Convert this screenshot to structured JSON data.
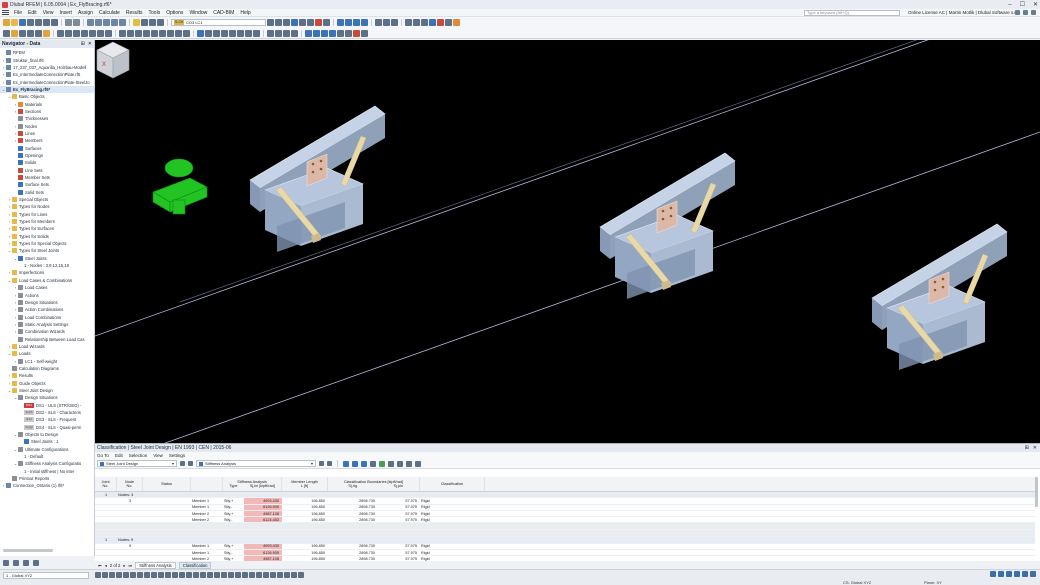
{
  "app": {
    "title": "Dlubal RFEM | 6.05.0004 | Ex_FlyBracing.rf6*",
    "window_controls": [
      "–",
      "☐",
      "✕"
    ]
  },
  "menu": {
    "items": [
      "File",
      "Edit",
      "View",
      "Insert",
      "Assign",
      "Calculate",
      "Results",
      "Tools",
      "Options",
      "Window",
      "CAD-BIM",
      "Help"
    ],
    "search_placeholder": "Type a keyword (Alt+Q)",
    "license": "Online License AC | Martin Motlik | Dlubal Software s.r.o."
  },
  "toolbar": {
    "load_case_tag": "S-Ch",
    "load_case": "CO3  LC1"
  },
  "navigator": {
    "title": "Navigator - Data",
    "items": [
      {
        "depth": 0,
        "tw": "",
        "icon": "ic-model",
        "icon_name": "rfem-icon",
        "label": "RFEM"
      },
      {
        "depth": 0,
        "tw": "›",
        "icon": "ic-model",
        "icon_name": "model-icon",
        "label": "Struktur_final.rf6"
      },
      {
        "depth": 0,
        "tw": "›",
        "icon": "ic-model",
        "icon_name": "model-icon",
        "label": "17_237_037_Aquarilla_Holzbau-Modell"
      },
      {
        "depth": 0,
        "tw": "›",
        "icon": "ic-model",
        "icon_name": "model-icon",
        "label": "Ex_IntermediateConnectionPlate.rf6"
      },
      {
        "depth": 0,
        "tw": "›",
        "icon": "ic-model",
        "icon_name": "model-icon",
        "label": "Ex_IntermediateConnectionPlate-SteelJo"
      },
      {
        "depth": 0,
        "tw": "⌄",
        "icon": "ic-model",
        "icon_name": "model-icon",
        "label": "Ex_FlyBracing.rf6*",
        "active": true
      },
      {
        "depth": 1,
        "tw": "⌄",
        "icon": "ic-folder",
        "icon_name": "folder-icon",
        "label": "Basic Objects"
      },
      {
        "depth": 2,
        "tw": "›",
        "icon": "ic-orange",
        "icon_name": "materials-icon",
        "label": "Materials"
      },
      {
        "depth": 2,
        "tw": "›",
        "icon": "ic-red",
        "icon_name": "sections-icon",
        "label": "Sections"
      },
      {
        "depth": 2,
        "tw": "",
        "icon": "ic-gray",
        "icon_name": "thicknesses-icon",
        "label": "Thicknesses"
      },
      {
        "depth": 2,
        "tw": "›",
        "icon": "ic-gray",
        "icon_name": "nodes-icon",
        "label": "Nodes"
      },
      {
        "depth": 2,
        "tw": "›",
        "icon": "ic-red",
        "icon_name": "lines-icon",
        "label": "Lines"
      },
      {
        "depth": 2,
        "tw": "›",
        "icon": "ic-red",
        "icon_name": "members-icon",
        "label": "Members"
      },
      {
        "depth": 2,
        "tw": "",
        "icon": "ic-blue",
        "icon_name": "surfaces-icon",
        "label": "Surfaces"
      },
      {
        "depth": 2,
        "tw": "",
        "icon": "ic-blue",
        "icon_name": "openings-icon",
        "label": "Openings"
      },
      {
        "depth": 2,
        "tw": "",
        "icon": "ic-blue",
        "icon_name": "solids-icon",
        "label": "Solids"
      },
      {
        "depth": 2,
        "tw": "",
        "icon": "ic-red",
        "icon_name": "line-sets-icon",
        "label": "Line Sets"
      },
      {
        "depth": 2,
        "tw": "",
        "icon": "ic-red",
        "icon_name": "member-sets-icon",
        "label": "Member Sets"
      },
      {
        "depth": 2,
        "tw": "",
        "icon": "ic-blue",
        "icon_name": "surface-sets-icon",
        "label": "Surface Sets"
      },
      {
        "depth": 2,
        "tw": "",
        "icon": "ic-blue",
        "icon_name": "solid-sets-icon",
        "label": "Solid Sets"
      },
      {
        "depth": 1,
        "tw": "›",
        "icon": "ic-folder",
        "icon_name": "folder-icon",
        "label": "Special Objects"
      },
      {
        "depth": 1,
        "tw": "›",
        "icon": "ic-folder",
        "icon_name": "folder-icon",
        "label": "Types for Nodes"
      },
      {
        "depth": 1,
        "tw": "›",
        "icon": "ic-folder",
        "icon_name": "folder-icon",
        "label": "Types for Lines"
      },
      {
        "depth": 1,
        "tw": "›",
        "icon": "ic-folder",
        "icon_name": "folder-icon",
        "label": "Types for Members"
      },
      {
        "depth": 1,
        "tw": "›",
        "icon": "ic-folder",
        "icon_name": "folder-icon",
        "label": "Types for Surfaces"
      },
      {
        "depth": 1,
        "tw": "›",
        "icon": "ic-folder",
        "icon_name": "folder-icon",
        "label": "Types for Solids"
      },
      {
        "depth": 1,
        "tw": "›",
        "icon": "ic-folder",
        "icon_name": "folder-icon",
        "label": "Types for Special Objects"
      },
      {
        "depth": 1,
        "tw": "⌄",
        "icon": "ic-folder",
        "icon_name": "folder-icon",
        "label": "Types for Steel Joints"
      },
      {
        "depth": 2,
        "tw": "⌄",
        "icon": "ic-blue",
        "icon_name": "steel-joints-icon",
        "label": "Steel Joints"
      },
      {
        "depth": 3,
        "tw": "",
        "icon": "",
        "icon_name": "",
        "label": "1 - Nodes : 3,9,12,15,18"
      },
      {
        "depth": 1,
        "tw": "›",
        "icon": "ic-folder",
        "icon_name": "folder-icon",
        "label": "Imperfections"
      },
      {
        "depth": 1,
        "tw": "⌄",
        "icon": "ic-folder",
        "icon_name": "folder-icon",
        "label": "Load Cases & Combinations"
      },
      {
        "depth": 2,
        "tw": "›",
        "icon": "ic-gray",
        "icon_name": "load-cases-icon",
        "label": "Load Cases"
      },
      {
        "depth": 2,
        "tw": "›",
        "icon": "ic-gray",
        "icon_name": "actions-icon",
        "label": "Actions"
      },
      {
        "depth": 2,
        "tw": "›",
        "icon": "ic-gray",
        "icon_name": "design-situations-icon",
        "label": "Design Situations"
      },
      {
        "depth": 2,
        "tw": "›",
        "icon": "ic-gray",
        "icon_name": "action-combinations-icon",
        "label": "Action Combinations"
      },
      {
        "depth": 2,
        "tw": "›",
        "icon": "ic-gray",
        "icon_name": "load-combinations-icon",
        "label": "Load Combinations"
      },
      {
        "depth": 2,
        "tw": "›",
        "icon": "ic-gray",
        "icon_name": "static-analysis-settings-icon",
        "label": "Static Analysis Settings"
      },
      {
        "depth": 2,
        "tw": "›",
        "icon": "ic-gray",
        "icon_name": "combination-wizards-icon",
        "label": "Combination Wizards"
      },
      {
        "depth": 2,
        "tw": "",
        "icon": "ic-gray",
        "icon_name": "relationship-icon",
        "label": "Relationship Between Load Cas"
      },
      {
        "depth": 1,
        "tw": "›",
        "icon": "ic-folder",
        "icon_name": "folder-icon",
        "label": "Load Wizards"
      },
      {
        "depth": 1,
        "tw": "⌄",
        "icon": "ic-folder",
        "icon_name": "folder-icon",
        "label": "Loads"
      },
      {
        "depth": 2,
        "tw": "›",
        "icon": "ic-gray",
        "icon_name": "load-case-icon",
        "label": "LC1 - Self-weight"
      },
      {
        "depth": 1,
        "tw": "",
        "icon": "ic-gray",
        "icon_name": "calculation-diagrams-icon",
        "label": "Calculation Diagrams"
      },
      {
        "depth": 1,
        "tw": "›",
        "icon": "ic-folder",
        "icon_name": "folder-icon",
        "label": "Results"
      },
      {
        "depth": 1,
        "tw": "›",
        "icon": "ic-folder",
        "icon_name": "folder-icon",
        "label": "Guide Objects"
      },
      {
        "depth": 1,
        "tw": "⌄",
        "icon": "ic-folder",
        "icon_name": "folder-icon",
        "label": "Steel Joint Design"
      },
      {
        "depth": 2,
        "tw": "⌄",
        "icon": "ic-gray",
        "icon_name": "design-situations-icon",
        "label": "Design Situations"
      },
      {
        "depth": 3,
        "tw": "",
        "icon": "ic-tag red",
        "icon_tag": "DS1",
        "icon_name": "ds-tag-icon",
        "label": "DS1 - ULS (STR/GEO) -"
      },
      {
        "depth": 3,
        "tw": "",
        "icon": "ic-tag",
        "icon_tag": "S-Ch",
        "icon_name": "ds-tag-icon",
        "label": "DS2 - SLS - Characteris"
      },
      {
        "depth": 3,
        "tw": "",
        "icon": "ic-tag",
        "icon_tag": "S-Fr",
        "icon_name": "ds-tag-icon",
        "label": "DS3 - SLS - Frequent"
      },
      {
        "depth": 3,
        "tw": "",
        "icon": "ic-tag",
        "icon_tag": "S-Qp",
        "icon_name": "ds-tag-icon",
        "label": "DS4 - SLS - Quasi-perm"
      },
      {
        "depth": 2,
        "tw": "⌄",
        "icon": "ic-gray",
        "icon_name": "objects-to-design-icon",
        "label": "Objects to Design"
      },
      {
        "depth": 3,
        "tw": "",
        "icon": "ic-blue",
        "icon_name": "steel-joints-icon",
        "label": "Steel Joints : 1"
      },
      {
        "depth": 2,
        "tw": "⌄",
        "icon": "ic-gray",
        "icon_name": "ultimate-configurations-icon",
        "label": "Ultimate Configurations"
      },
      {
        "depth": 3,
        "tw": "",
        "icon": "",
        "icon_name": "",
        "label": "1 - Default"
      },
      {
        "depth": 2,
        "tw": "⌄",
        "icon": "ic-gray",
        "icon_name": "stiffness-config-icon",
        "label": "Stiffness Analysis Configuratio"
      },
      {
        "depth": 3,
        "tw": "",
        "icon": "",
        "icon_name": "",
        "label": "1 - Initial stiffness | No inter"
      },
      {
        "depth": 1,
        "tw": "",
        "icon": "ic-gray",
        "icon_name": "printout-reports-icon",
        "label": "Printout Reports"
      },
      {
        "depth": 0,
        "tw": "›",
        "icon": "ic-model",
        "icon_name": "model-icon",
        "label": "Connection_Ontario (1).rf6*"
      }
    ]
  },
  "panel": {
    "title": "Classification | Steel Joint Design | EN 1993 | CEN | 2015-06",
    "menu": [
      "Go To",
      "Edit",
      "Selection",
      "View",
      "Settings"
    ],
    "combo_module": "Steel Joint Design",
    "combo_analysis": "Stiffness Analysis",
    "headers": {
      "joint": [
        "Joint",
        "No."
      ],
      "node": [
        "Node",
        "No."
      ],
      "status": [
        "",
        "Status"
      ],
      "blank": [
        "",
        ""
      ],
      "type": [
        "Stiffness Analysis",
        "Type"
      ],
      "sj": [
        "",
        "Sj,ini [kipft/rad]"
      ],
      "len": [
        "Member Length",
        "L [ft]"
      ],
      "bounds_title": "Classification Boundaries [kipft/rad]",
      "sjr": "Sj,rig",
      "sjp": "Sj,pin",
      "class": [
        "",
        "Classification"
      ]
    },
    "rows": [
      {
        "kind": "group",
        "joint": "1",
        "node": "Nodes: 3"
      },
      {
        "kind": "data",
        "node": "3",
        "member": "Member 1",
        "type": "Stiy,+",
        "sj": "4993.430",
        "len": "196.850",
        "sjr": "2898.730",
        "sjp": "57.975",
        "cls": "Rigid"
      },
      {
        "kind": "data",
        "node": "",
        "member": "Member 1",
        "type": "Stiy,-",
        "sj": "6126.905",
        "len": "196.850",
        "sjr": "2898.730",
        "sjp": "57.975",
        "cls": "Rigid"
      },
      {
        "kind": "data",
        "node": "",
        "member": "Member 2",
        "type": "Stiy,+",
        "sj": "4987.108",
        "len": "196.850",
        "sjr": "2898.730",
        "sjp": "57.975",
        "cls": "Rigid"
      },
      {
        "kind": "data",
        "node": "",
        "member": "Member 2",
        "type": "Stiy,-",
        "sj": "6124.453",
        "len": "196.850",
        "sjr": "2898.730",
        "sjp": "57.975",
        "cls": "Rigid"
      },
      {
        "kind": "spacer"
      },
      {
        "kind": "spacer"
      },
      {
        "kind": "group",
        "joint": "1",
        "node": "Nodes: 9"
      },
      {
        "kind": "data",
        "node": "9",
        "member": "Member 1",
        "type": "Stiy,+",
        "sj": "4993.430",
        "len": "196.850",
        "sjr": "2898.730",
        "sjp": "57.975",
        "cls": "Rigid"
      },
      {
        "kind": "data",
        "node": "",
        "member": "Member 1",
        "type": "Stiy,-",
        "sj": "6126.905",
        "len": "196.850",
        "sjr": "2898.730",
        "sjp": "57.975",
        "cls": "Rigid"
      },
      {
        "kind": "data",
        "node": "",
        "member": "Member 2",
        "type": "Stiy,+",
        "sj": "4987.108",
        "len": "196.850",
        "sjr": "2898.730",
        "sjp": "57.975",
        "cls": "Rigid"
      },
      {
        "kind": "data",
        "node": "",
        "member": "Member 2",
        "type": "Stiy,-",
        "sj": "6124.453",
        "len": "196.850",
        "sjr": "2898.730",
        "sjp": "57.975",
        "cls": "Rigid"
      }
    ],
    "pager": "2 of 2",
    "tabs": [
      "Stiffness Analysis",
      "Classification"
    ],
    "active_tab": "Classification"
  },
  "statusbar": {
    "cs_combo": "1 - Global XYZ",
    "cs": "CS: Global XYZ",
    "plane": "Plane: XY"
  },
  "viewcube": {
    "label": "X"
  },
  "colors": {
    "accent": "#3c72b8",
    "highlight_cell": "#f3b9b9",
    "viewport_bg": "#000000",
    "steel": "#b7c6dc",
    "brace": "#e8d9a8",
    "support": "#22cc22"
  }
}
